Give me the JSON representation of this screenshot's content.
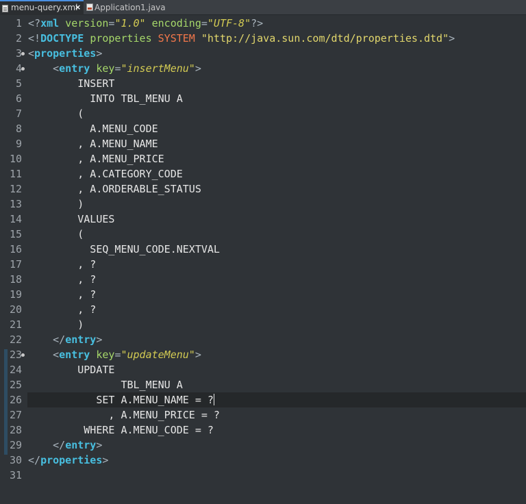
{
  "tabs": [
    {
      "label": "menu-query.xml",
      "close": "×",
      "active": true
    },
    {
      "label": "Application1.java",
      "active": false
    }
  ],
  "editor": {
    "lines": [
      {
        "n": "1",
        "fold": false,
        "tokens": [
          [
            "c-punct",
            "<?"
          ],
          [
            "c-tag",
            "xml"
          ],
          [
            "c-text",
            " "
          ],
          [
            "c-attr",
            "version"
          ],
          [
            "c-punct",
            "="
          ],
          [
            "c-str",
            "\"1.0\""
          ],
          [
            "c-text",
            " "
          ],
          [
            "c-attr",
            "encoding"
          ],
          [
            "c-punct",
            "="
          ],
          [
            "c-str",
            "\"UTF-8\""
          ],
          [
            "c-punct",
            "?>"
          ]
        ]
      },
      {
        "n": "2",
        "fold": false,
        "tokens": [
          [
            "c-punct",
            "<!"
          ],
          [
            "c-tag",
            "DOCTYPE"
          ],
          [
            "c-text",
            " "
          ],
          [
            "c-doctype",
            "properties"
          ],
          [
            "c-text",
            " "
          ],
          [
            "c-system",
            "SYSTEM"
          ],
          [
            "c-text",
            " "
          ],
          [
            "c-str-plain",
            "\"http://java.sun.com/dtd/properties.dtd\""
          ],
          [
            "c-punct",
            ">"
          ]
        ]
      },
      {
        "n": "3",
        "fold": true,
        "tokens": [
          [
            "c-punct",
            "<"
          ],
          [
            "c-tag",
            "properties"
          ],
          [
            "c-punct",
            ">"
          ]
        ]
      },
      {
        "n": "4",
        "fold": true,
        "tokens": [
          [
            "c-text",
            "    "
          ],
          [
            "c-punct",
            "<"
          ],
          [
            "c-tag",
            "entry"
          ],
          [
            "c-text",
            " "
          ],
          [
            "c-attr",
            "key"
          ],
          [
            "c-punct",
            "="
          ],
          [
            "c-str",
            "\"insertMenu\""
          ],
          [
            "c-punct",
            ">"
          ]
        ]
      },
      {
        "n": "5",
        "fold": false,
        "tokens": [
          [
            "c-text",
            "        INSERT"
          ]
        ]
      },
      {
        "n": "6",
        "fold": false,
        "tokens": [
          [
            "c-text",
            "          INTO TBL_MENU A"
          ]
        ]
      },
      {
        "n": "7",
        "fold": false,
        "tokens": [
          [
            "c-text",
            "        ("
          ]
        ]
      },
      {
        "n": "8",
        "fold": false,
        "tokens": [
          [
            "c-text",
            "          A.MENU_CODE"
          ]
        ]
      },
      {
        "n": "9",
        "fold": false,
        "tokens": [
          [
            "c-text",
            "        , A.MENU_NAME"
          ]
        ]
      },
      {
        "n": "10",
        "fold": false,
        "tokens": [
          [
            "c-text",
            "        , A.MENU_PRICE"
          ]
        ]
      },
      {
        "n": "11",
        "fold": false,
        "tokens": [
          [
            "c-text",
            "        , A.CATEGORY_CODE"
          ]
        ]
      },
      {
        "n": "12",
        "fold": false,
        "tokens": [
          [
            "c-text",
            "        , A.ORDERABLE_STATUS"
          ]
        ]
      },
      {
        "n": "13",
        "fold": false,
        "tokens": [
          [
            "c-text",
            "        )"
          ]
        ]
      },
      {
        "n": "14",
        "fold": false,
        "tokens": [
          [
            "c-text",
            "        VALUES"
          ]
        ]
      },
      {
        "n": "15",
        "fold": false,
        "tokens": [
          [
            "c-text",
            "        ("
          ]
        ]
      },
      {
        "n": "16",
        "fold": false,
        "tokens": [
          [
            "c-text",
            "          SEQ_MENU_CODE.NEXTVAL"
          ]
        ]
      },
      {
        "n": "17",
        "fold": false,
        "tokens": [
          [
            "c-text",
            "        , ?"
          ]
        ]
      },
      {
        "n": "18",
        "fold": false,
        "tokens": [
          [
            "c-text",
            "        , ?"
          ]
        ]
      },
      {
        "n": "19",
        "fold": false,
        "tokens": [
          [
            "c-text",
            "        , ?"
          ]
        ]
      },
      {
        "n": "20",
        "fold": false,
        "tokens": [
          [
            "c-text",
            "        , ?"
          ]
        ]
      },
      {
        "n": "21",
        "fold": false,
        "tokens": [
          [
            "c-text",
            "        )"
          ]
        ]
      },
      {
        "n": "22",
        "fold": false,
        "tokens": [
          [
            "c-text",
            "    "
          ],
          [
            "c-punct",
            "</"
          ],
          [
            "c-tag",
            "entry"
          ],
          [
            "c-punct",
            ">"
          ]
        ]
      },
      {
        "n": "23",
        "fold": true,
        "tokens": [
          [
            "c-text",
            "    "
          ],
          [
            "c-punct",
            "<"
          ],
          [
            "c-tag",
            "entry"
          ],
          [
            "c-text",
            " "
          ],
          [
            "c-attr",
            "key"
          ],
          [
            "c-punct",
            "="
          ],
          [
            "c-str",
            "\"updateMenu\""
          ],
          [
            "c-punct",
            ">"
          ]
        ]
      },
      {
        "n": "24",
        "fold": false,
        "tokens": [
          [
            "c-text",
            "        UPDATE"
          ]
        ]
      },
      {
        "n": "25",
        "fold": false,
        "tokens": [
          [
            "c-text",
            "               TBL_MENU A"
          ]
        ]
      },
      {
        "n": "26",
        "fold": false,
        "current": true,
        "tokens": [
          [
            "c-text",
            "           SET A.MENU_NAME = ?"
          ]
        ]
      },
      {
        "n": "27",
        "fold": false,
        "tokens": [
          [
            "c-text",
            "             , A.MENU_PRICE = ?"
          ]
        ]
      },
      {
        "n": "28",
        "fold": false,
        "tokens": [
          [
            "c-text",
            "         WHERE A.MENU_CODE = ?"
          ]
        ]
      },
      {
        "n": "29",
        "fold": false,
        "tokens": [
          [
            "c-text",
            "    "
          ],
          [
            "c-punct",
            "</"
          ],
          [
            "c-tag",
            "entry"
          ],
          [
            "c-punct",
            ">"
          ]
        ]
      },
      {
        "n": "30",
        "fold": false,
        "tokens": [
          [
            "c-punct",
            "</"
          ],
          [
            "c-tag",
            "properties"
          ],
          [
            "c-punct",
            ">"
          ]
        ]
      },
      {
        "n": "31",
        "fold": false,
        "tokens": []
      }
    ]
  }
}
